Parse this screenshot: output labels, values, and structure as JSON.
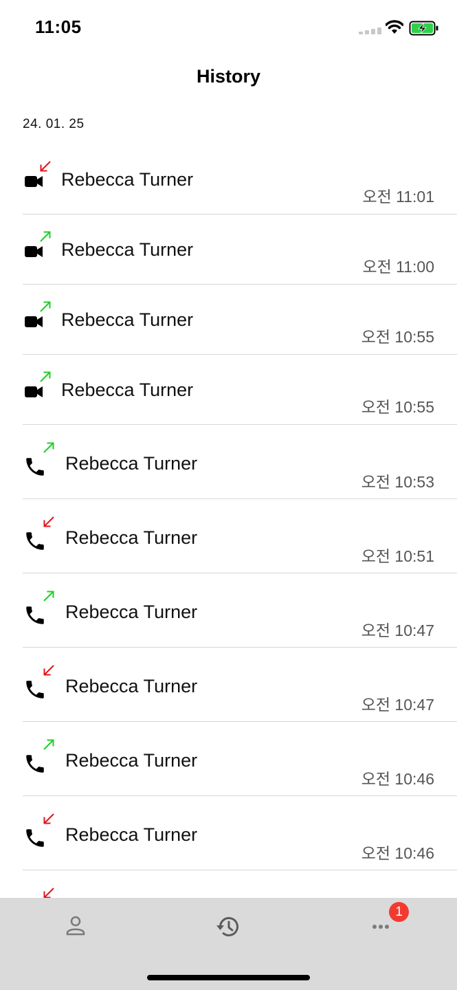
{
  "status_bar": {
    "time": "11:05",
    "battery_charging": true
  },
  "header": {
    "title": "History"
  },
  "date_header": "24. 01. 25",
  "colors": {
    "incoming": "#e0141e",
    "outgoing": "#1fcf24",
    "badge": "#f23a30",
    "tab_bar": "#dadada",
    "time_text": "#555555"
  },
  "calls": [
    {
      "type": "video",
      "direction": "incoming",
      "name": "Rebecca Turner",
      "time": "오전 11:01"
    },
    {
      "type": "video",
      "direction": "outgoing",
      "name": "Rebecca Turner",
      "time": "오전 11:00"
    },
    {
      "type": "video",
      "direction": "outgoing",
      "name": "Rebecca Turner",
      "time": "오전 10:55"
    },
    {
      "type": "video",
      "direction": "outgoing",
      "name": "Rebecca Turner",
      "time": "오전 10:55"
    },
    {
      "type": "voice",
      "direction": "outgoing",
      "name": "Rebecca Turner",
      "time": "오전 10:53"
    },
    {
      "type": "voice",
      "direction": "incoming",
      "name": "Rebecca Turner",
      "time": "오전 10:51"
    },
    {
      "type": "voice",
      "direction": "outgoing",
      "name": "Rebecca Turner",
      "time": "오전 10:47"
    },
    {
      "type": "voice",
      "direction": "incoming",
      "name": "Rebecca Turner",
      "time": "오전 10:47"
    },
    {
      "type": "voice",
      "direction": "outgoing",
      "name": "Rebecca Turner",
      "time": "오전 10:46"
    },
    {
      "type": "voice",
      "direction": "incoming",
      "name": "Rebecca Turner",
      "time": "오전 10:46"
    },
    {
      "type": "voice",
      "direction": "incoming",
      "name": "",
      "time": ""
    }
  ],
  "tab_bar": {
    "tabs": [
      {
        "id": "contacts",
        "icon": "person-icon"
      },
      {
        "id": "history",
        "icon": "history-icon"
      },
      {
        "id": "more",
        "icon": "more-icon"
      }
    ],
    "more_badge": "1"
  }
}
